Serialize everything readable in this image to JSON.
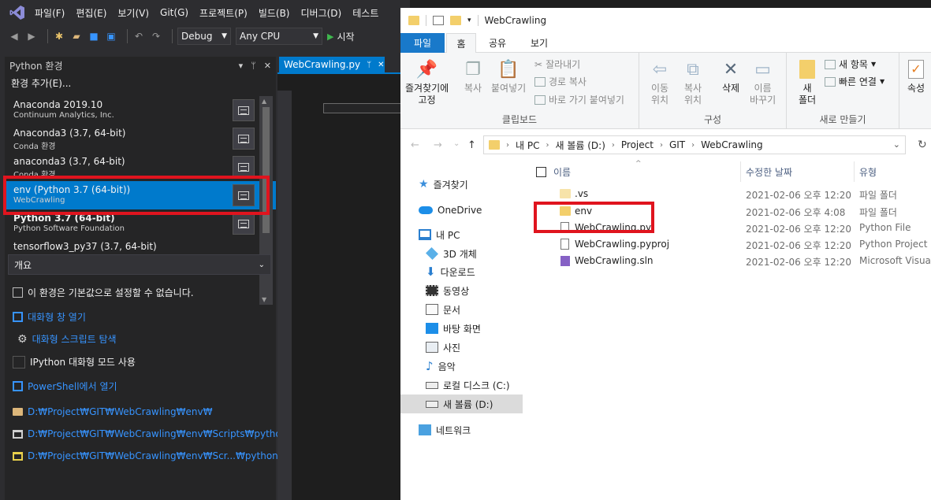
{
  "vs": {
    "menu": [
      "파일(F)",
      "편집(E)",
      "보기(V)",
      "Git(G)",
      "프로젝트(P)",
      "빌드(B)",
      "디버그(D)",
      "테스트"
    ],
    "toolbar": {
      "config": "Debug",
      "platform": "Any CPU",
      "start": "시작"
    },
    "python_panel": {
      "title": "Python 환경",
      "add_env": "환경 추가(E)...",
      "environments": [
        {
          "name": "Anaconda 2019.10",
          "sub": "Continuum Analytics, Inc."
        },
        {
          "name": "Anaconda3 (3.7, 64-bit)",
          "sub": "Conda 환경"
        },
        {
          "name": "anaconda3 (3.7, 64-bit)",
          "sub": "Conda 환경"
        },
        {
          "name": "env (Python 3.7 (64-bit))",
          "sub": "WebCrawling",
          "selected": true
        },
        {
          "name": "Python 3.7 (64-bit)",
          "sub": "Python Software Foundation",
          "bold": true
        },
        {
          "name": "tensorflow3_py37 (3.7, 64-bit)",
          "sub": ""
        }
      ],
      "overview_label": "개요",
      "overview": {
        "default_note": "이 환경은 기본값으로 설정할 수 없습니다.",
        "interactive_window": "대화형 창 열기",
        "browse_scripts": "대화형 스크립트 탐색",
        "ipython_mode": "IPython 대화형 모드 사용",
        "powershell": "PowerShell에서 열기",
        "path_env": "D:₩Project₩GIT₩WebCrawling₩env₩",
        "path_python": "D:₩Project₩GIT₩WebCrawling₩env₩Scripts₩python.exe",
        "path_pythonw": "D:₩Project₩GIT₩WebCrawling₩env₩Scr...₩pythonw.exe"
      }
    },
    "editor_tab": "WebCrawling.py"
  },
  "explorer": {
    "title": "WebCrawling",
    "tabs": {
      "file": "파일",
      "home": "홈",
      "share": "공유",
      "view": "보기"
    },
    "ribbon": {
      "pin": "즐겨찾기에\n고정",
      "copy": "복사",
      "paste": "붙여넣기",
      "cut": "잘라내기",
      "copy_path": "경로 복사",
      "paste_shortcut": "바로 가기 붙여넣기",
      "clipboard_group": "클립보드",
      "move_to": "이동\n위치",
      "copy_to": "복사\n위치",
      "delete": "삭제",
      "rename": "이름\n바꾸기",
      "organize_group": "구성",
      "new_folder": "새\n폴더",
      "new_item": "새 항목",
      "easy_access": "빠른 연결",
      "new_group": "새로 만들기",
      "properties": "속성"
    },
    "breadcrumb": [
      "내 PC",
      "새 볼륨 (D:)",
      "Project",
      "GIT",
      "WebCrawling"
    ],
    "nav": {
      "quick_access": "즐겨찾기",
      "onedrive": "OneDrive",
      "this_pc": "내 PC",
      "objects3d": "3D 개체",
      "downloads": "다운로드",
      "videos": "동영상",
      "documents": "문서",
      "desktop": "바탕 화면",
      "pictures": "사진",
      "music": "음악",
      "local_disk": "로컬 디스크 (C:)",
      "new_volume": "새 볼륨 (D:)",
      "network": "네트워크"
    },
    "columns": {
      "name": "이름",
      "date": "수정한 날짜",
      "type": "유형"
    },
    "files": [
      {
        "name": ".vs",
        "date": "2021-02-06 오후 12:20",
        "type": "파일 폴더",
        "icon": "folder-light"
      },
      {
        "name": "env",
        "date": "2021-02-06 오후 4:08",
        "type": "파일 폴더",
        "icon": "folder"
      },
      {
        "name": "WebCrawling.py",
        "date": "2021-02-06 오후 12:20",
        "type": "Python File",
        "icon": "file"
      },
      {
        "name": "WebCrawling.pyproj",
        "date": "2021-02-06 오후 12:20",
        "type": "Python Project",
        "icon": "file"
      },
      {
        "name": "WebCrawling.sln",
        "date": "2021-02-06 오후 12:20",
        "type": "Microsoft Visual",
        "icon": "sln"
      }
    ]
  }
}
